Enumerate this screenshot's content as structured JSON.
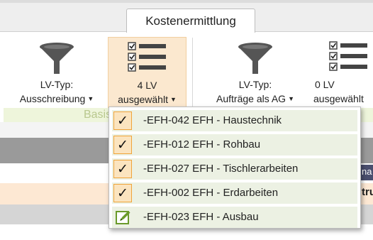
{
  "tab": {
    "label": "Kostenermittlung"
  },
  "ribbon": {
    "lvtyp_ausschreibung": {
      "line1": "LV-Typ:",
      "line2": "Ausschreibung"
    },
    "lv_selected_1": {
      "line1": "4 LV",
      "line2": "ausgewählt"
    },
    "lvtyp_auftraege": {
      "line1": "LV-Typ:",
      "line2": "Aufträge als AG"
    },
    "lv_selected_2": {
      "line1": "0 LV",
      "line2": "ausgewählt"
    },
    "group_label": "Basis"
  },
  "dropdown": {
    "items": [
      {
        "label": "-EFH-042 EFH - Haustechnik",
        "checked": true
      },
      {
        "label": "-EFH-012 EFH - Rohbau",
        "checked": true
      },
      {
        "label": "-EFH-027 EFH - Tischlerarbeiten",
        "checked": true
      },
      {
        "label": "-EFH-002 EFH - Erdarbeiten",
        "checked": true
      },
      {
        "label": "-EFH-023 EFH - Ausbau",
        "checked": false
      }
    ]
  },
  "behind": {
    "right_text_1": "na",
    "right_text_2": "tru"
  },
  "colors": {
    "active_button": "#fbe8cf",
    "check_bg": "#fbe4bf",
    "check_border": "#f0a43a",
    "item_bg": "#ecf1e3",
    "group_bg": "#eef5db"
  },
  "icons": [
    "funnel-icon",
    "list-check-icon",
    "checkmark-icon",
    "edit-icon",
    "caret-down-icon"
  ]
}
